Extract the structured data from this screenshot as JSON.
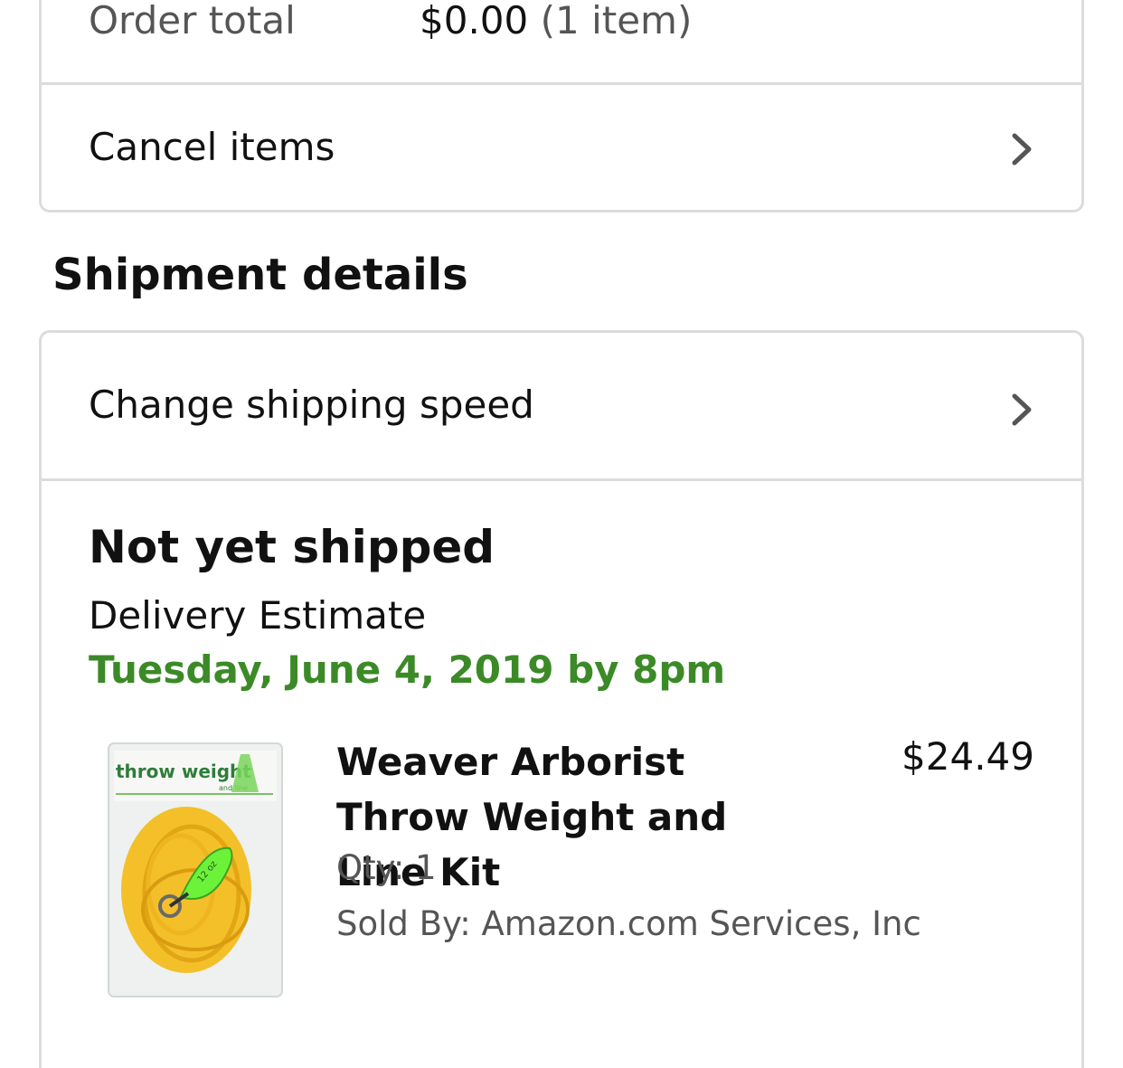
{
  "order_summary": {
    "total_label": "Order total",
    "total_amount": "$0.00",
    "total_count": "(1 item)",
    "cancel_label": "Cancel items"
  },
  "shipment": {
    "heading": "Shipment details",
    "change_speed_label": "Change shipping speed",
    "status": "Not yet shipped",
    "estimate_label": "Delivery Estimate",
    "estimate_date": "Tuesday, June 4, 2019 by 8pm",
    "accent_color": "#3b8a27"
  },
  "item": {
    "name": "Weaver Arborist Throw Weight and Line Kit",
    "price": "$24.49",
    "quantity": "Qty: 1",
    "seller": "Sold By: Amazon.com Services, Inc",
    "image": {
      "alt": "Weaver Arborist Throw Weight and Line Kit",
      "header_text": "throw weight",
      "header_subtext": "and line",
      "weight_label": "12 oz"
    }
  },
  "icons": {
    "row_chevron": "chevron-right-icon"
  }
}
